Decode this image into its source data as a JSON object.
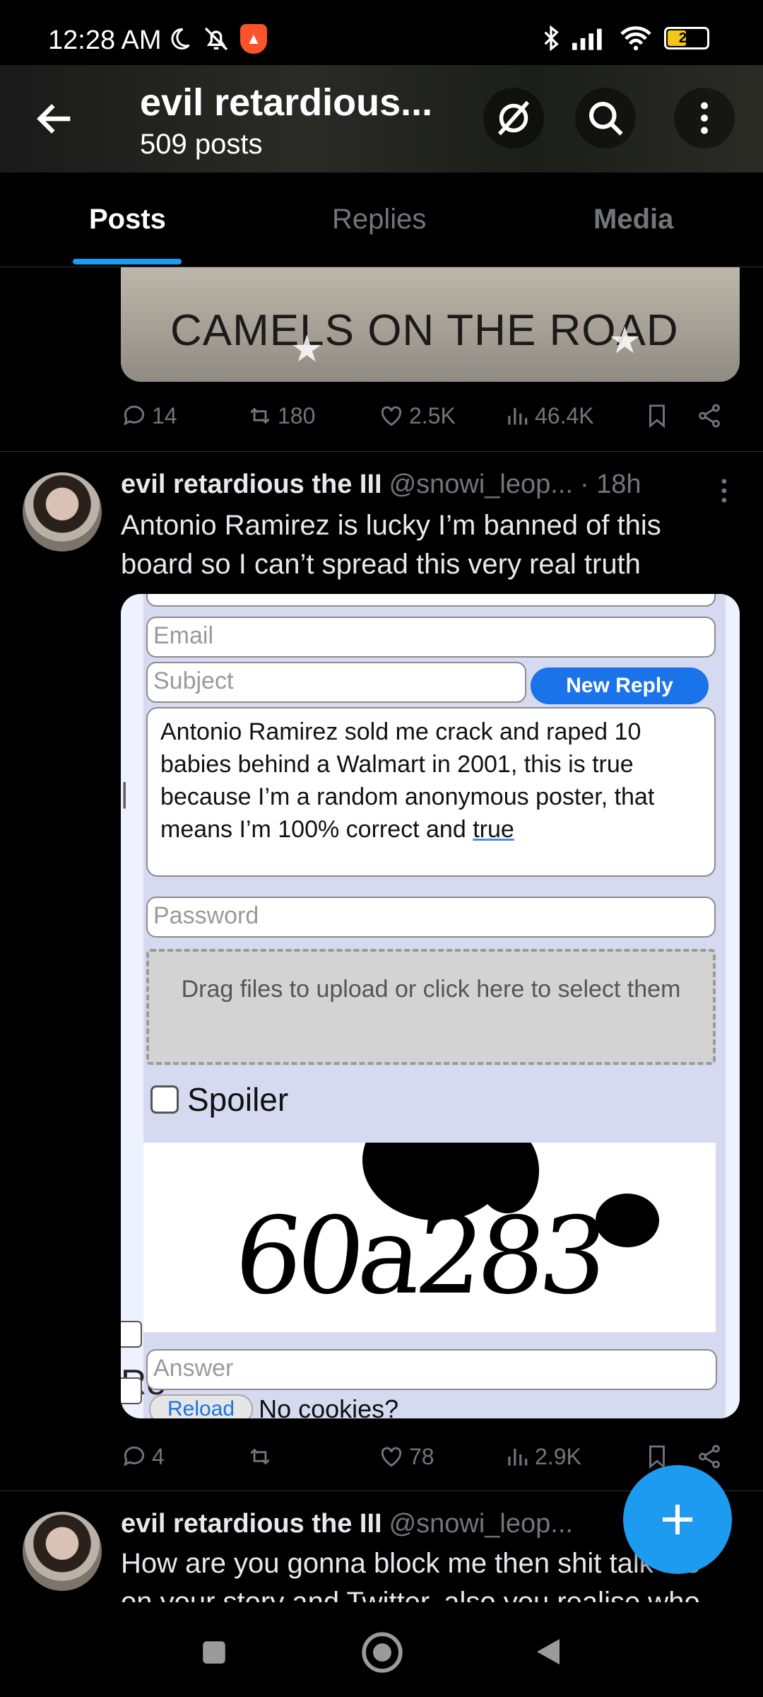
{
  "status_bar": {
    "time": "12:28 AM",
    "battery": "29"
  },
  "header": {
    "title": "evil retardious...",
    "post_count": "509 posts"
  },
  "tabs": [
    {
      "label": "Posts",
      "active": true
    },
    {
      "label": "Replies",
      "active": false
    },
    {
      "label": "Media",
      "active": false
    }
  ],
  "tweet1": {
    "image_text": "CAMELS ON THE ROAD",
    "replies": "14",
    "reposts": "180",
    "likes": "2.5K",
    "views": "46.4K"
  },
  "tweet2": {
    "name": "evil retardious the III",
    "handle": "@snowi_leop...",
    "time": "· 18h",
    "text": "Antonio Ramirez is lucky I’m banned of this board so I can’t spread this very real truth",
    "form": {
      "email_placeholder": "Email",
      "subject_placeholder": "Subject",
      "new_reply_button": "New Reply",
      "message_main": "Antonio Ramirez sold me crack and raped 10 babies behind a Walmart in 2001, this is true because I’m a random anonymous poster, that means I’m 100% correct and ",
      "message_underlined": "true",
      "password_placeholder": "Password",
      "drop_text": "Drag files to upload or click here to select them",
      "spoiler_label": "Spoiler",
      "captcha_text": "60a283",
      "answer_placeholder": "Answer",
      "reload_label": "Reload",
      "no_cookies": "No cookies?"
    },
    "replies": "4",
    "reposts": "",
    "likes": "78",
    "views": "2.9K"
  },
  "tweet3": {
    "name": "evil retardious the III",
    "handle": "@snowi_leop...",
    "text": "How are you gonna block me then shit talk me on your story and Twitter, also you realise who"
  },
  "colors": {
    "accent": "#1d9bf0",
    "muted": "#71767b",
    "background": "#000000"
  }
}
